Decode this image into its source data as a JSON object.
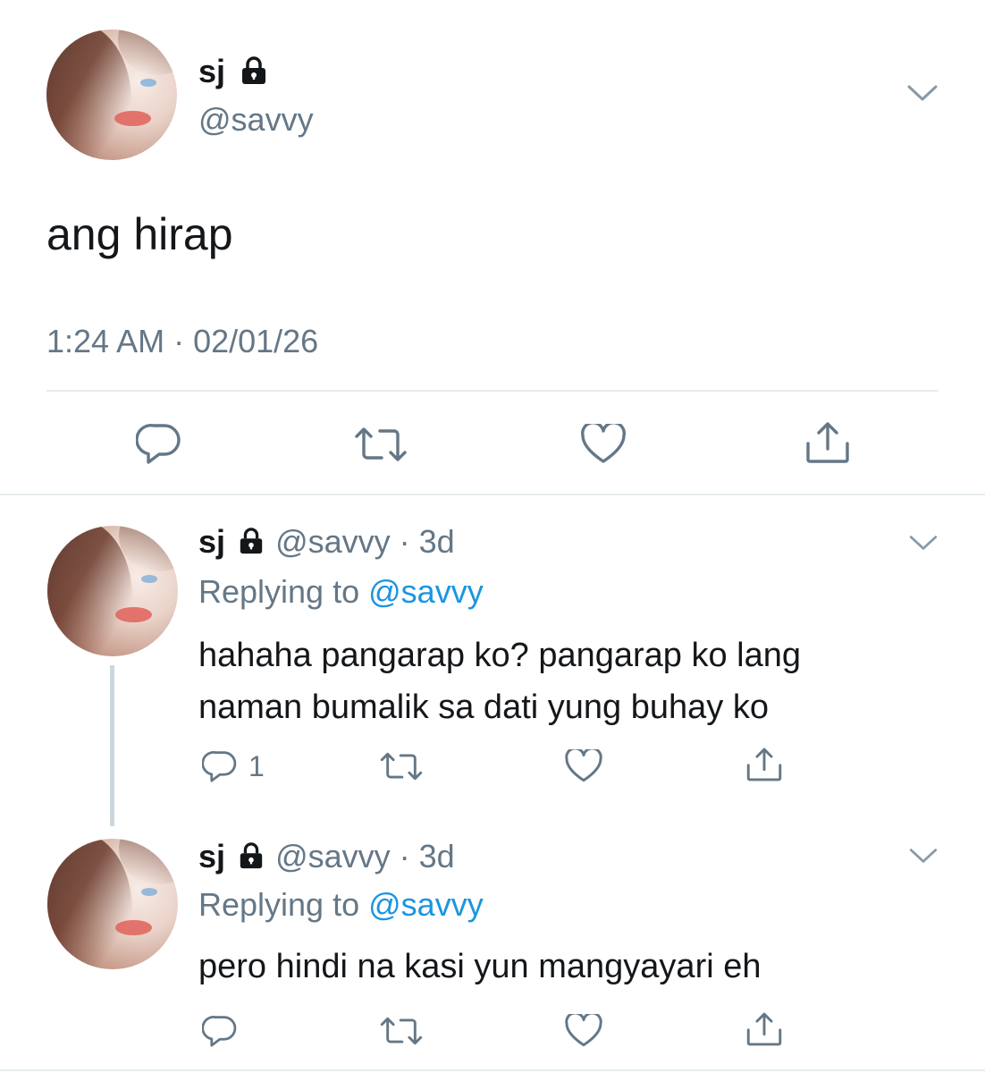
{
  "main_tweet": {
    "display_name": "sj",
    "handle": "@savvy",
    "text": "ang hirap",
    "timestamp": "1:24 AM · 02/01/26"
  },
  "replies": [
    {
      "display_name": "sj",
      "handle": "@savvy",
      "age": "· 3d",
      "replying_prefix": "Replying to",
      "replying_handle": "@savvy",
      "text_lines": [
        "hahaha pangarap ko? pangarap ko lang",
        "naman bumalik sa dati yung buhay ko"
      ],
      "reply_count": "1"
    },
    {
      "display_name": "sj",
      "handle": "@savvy",
      "age": "· 3d",
      "replying_prefix": "Replying to",
      "replying_handle": "@savvy",
      "text_lines": [
        "pero hindi na kasi yun mangyayari eh"
      ],
      "reply_count": ""
    }
  ],
  "colors": {
    "text": "#14171a",
    "secondary": "#657786",
    "link": "#1b95e0",
    "divider": "#e6ecf0"
  },
  "icons": [
    "lock-icon",
    "chevron-down-icon",
    "reply-icon",
    "retweet-icon",
    "like-icon",
    "share-icon"
  ]
}
